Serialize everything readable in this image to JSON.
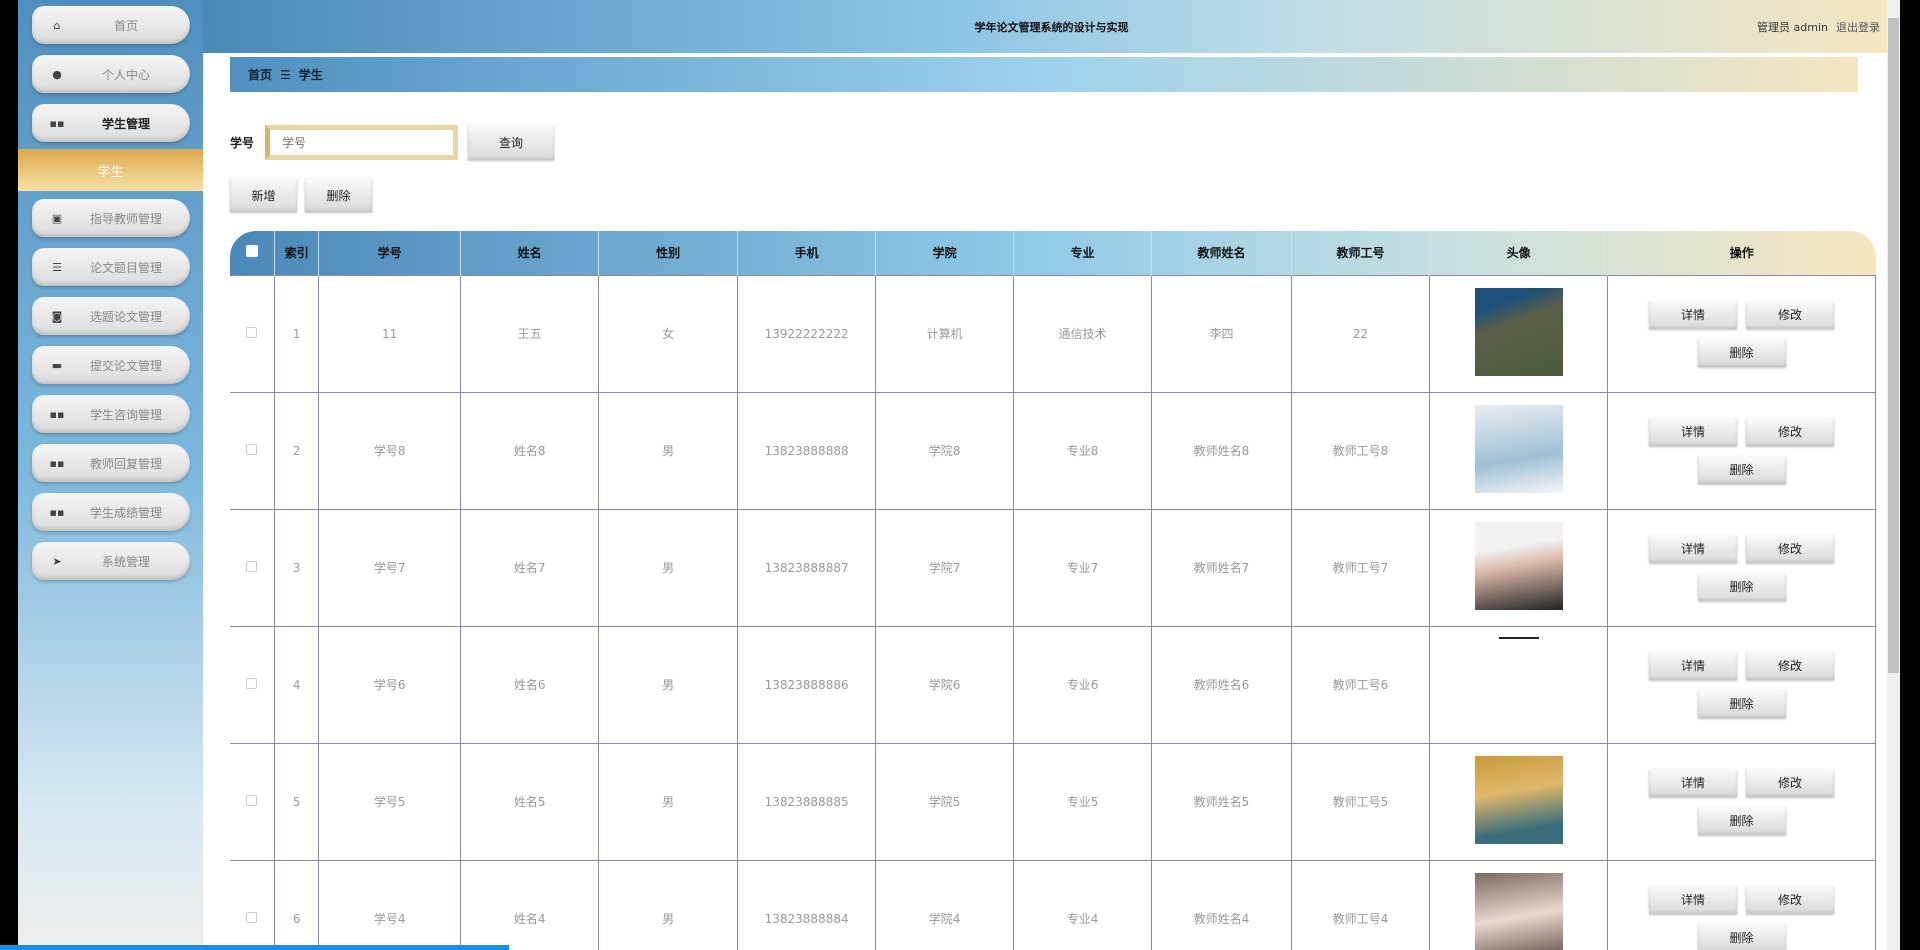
{
  "sidebar": {
    "items": [
      {
        "label": "首页",
        "icon": "home-icon"
      },
      {
        "label": "个人中心",
        "icon": "user-icon"
      },
      {
        "label": "学生管理",
        "icon": "grid-icon"
      },
      {
        "label": "指导教师管理",
        "icon": "clipboard-icon"
      },
      {
        "label": "论文题目管理",
        "icon": "list-icon"
      },
      {
        "label": "选题论文管理",
        "icon": "ticket-icon"
      },
      {
        "label": "提交论文管理",
        "icon": "comment-icon"
      },
      {
        "label": "学生咨询管理",
        "icon": "grid-icon"
      },
      {
        "label": "教师回复管理",
        "icon": "grid-icon"
      },
      {
        "label": "学生成绩管理",
        "icon": "grid-icon"
      },
      {
        "label": "系统管理",
        "icon": "send-icon"
      }
    ],
    "active_sub": "学生"
  },
  "header": {
    "title": "学年论文管理系统的设计与实现",
    "user": "管理员 admin",
    "logout": "退出登录"
  },
  "breadcrumb": {
    "home": "首页",
    "sep": "☰",
    "current": "学生"
  },
  "search": {
    "label": "学号",
    "placeholder": "学号",
    "query": "查询"
  },
  "actions": {
    "add": "新增",
    "delete": "删除"
  },
  "table": {
    "columns": [
      "索引",
      "学号",
      "姓名",
      "性别",
      "手机",
      "学院",
      "专业",
      "教师姓名",
      "教师工号",
      "头像",
      "操作"
    ],
    "rows": [
      [
        "1",
        "11",
        "王五",
        "女",
        "13922222222",
        "计算机",
        "通信技术",
        "李四",
        "22"
      ],
      [
        "2",
        "学号8",
        "姓名8",
        "男",
        "13823888888",
        "学院8",
        "专业8",
        "教师姓名8",
        "教师工号8"
      ],
      [
        "3",
        "学号7",
        "姓名7",
        "男",
        "13823888887",
        "学院7",
        "专业7",
        "教师姓名7",
        "教师工号7"
      ],
      [
        "4",
        "学号6",
        "姓名6",
        "男",
        "13823888886",
        "学院6",
        "专业6",
        "教师姓名6",
        "教师工号6"
      ],
      [
        "5",
        "学号5",
        "姓名5",
        "男",
        "13823888885",
        "学院5",
        "专业5",
        "教师姓名5",
        "教师工号5"
      ],
      [
        "6",
        "学号4",
        "姓名4",
        "男",
        "13823888884",
        "学院4",
        "专业4",
        "教师姓名4",
        "教师工号4"
      ]
    ],
    "row_actions": {
      "detail": "详情",
      "edit": "修改",
      "delete": "删除"
    }
  },
  "video_progress": 0.265
}
